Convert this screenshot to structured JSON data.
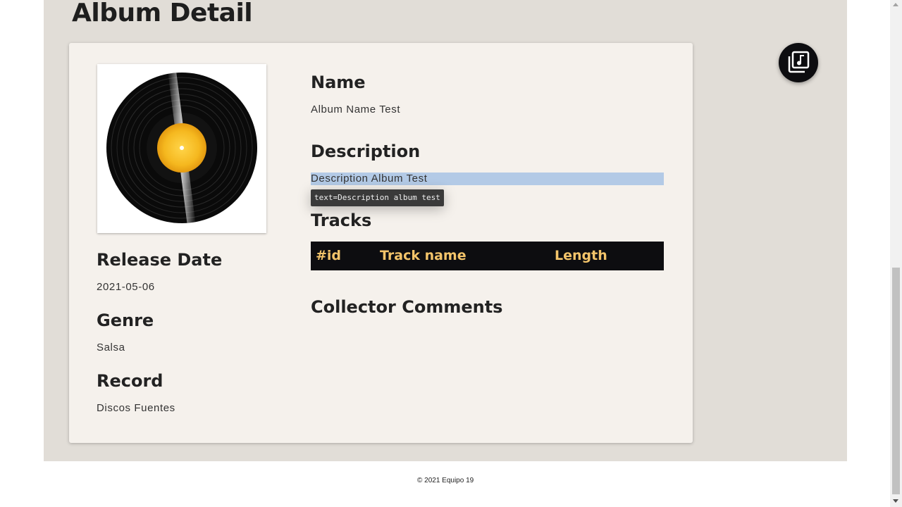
{
  "page": {
    "title": "Album Detail"
  },
  "album": {
    "cover_icon": "vinyl-record-image",
    "name_label": "Name",
    "name_value": "Album Name Test",
    "description_label": "Description",
    "description_value": "Description Album Test",
    "release_label": "Release Date",
    "release_value": "2021-05-06",
    "genre_label": "Genre",
    "genre_value": "Salsa",
    "record_label": "Record",
    "record_value": "Discos Fuentes"
  },
  "tooltip": {
    "text": "text=Description album test"
  },
  "tracks": {
    "label": "Tracks",
    "columns": [
      "#id",
      "Track name",
      "Length"
    ],
    "rows": []
  },
  "comments": {
    "label": "Collector Comments"
  },
  "fab": {
    "icon": "music-library-icon"
  },
  "footer": {
    "text": "© 2021 Equipo 19"
  },
  "colors": {
    "page_bg": "#e1ddd7",
    "card_bg": "#f5f1ec",
    "header_bg": "#0d0d10",
    "header_text": "#f3c46a",
    "selection": "#b3cae6"
  }
}
